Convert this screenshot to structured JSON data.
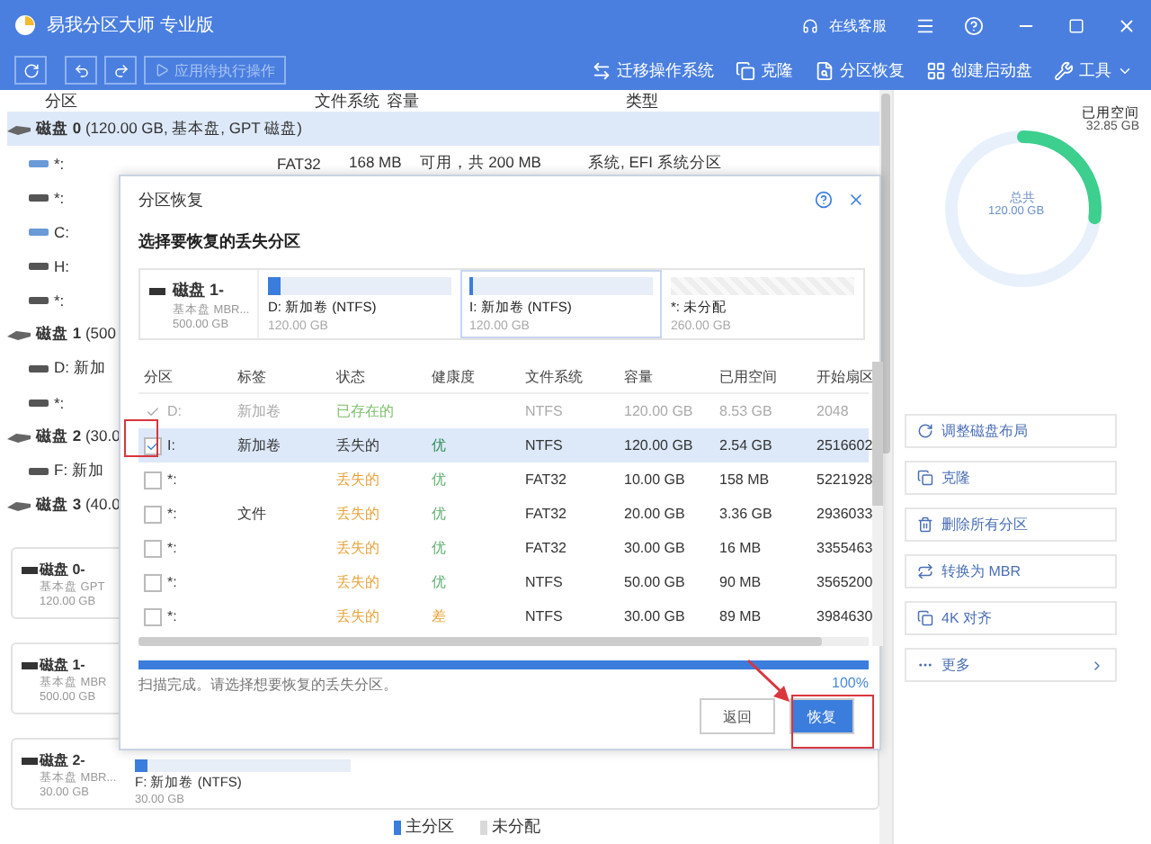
{
  "window": {
    "title": "易我分区大师 专业版",
    "support": "在线客服"
  },
  "toolbar": {
    "apply": {
      "label": "应用待执行操作",
      "disabled": true
    },
    "tools": [
      {
        "kind": "migrate",
        "label": "迁移操作系统"
      },
      {
        "kind": "clone",
        "label": "克隆"
      },
      {
        "kind": "recover",
        "label": "分区恢复"
      },
      {
        "kind": "bootdisk",
        "label": "创建启动盘"
      },
      {
        "kind": "tools",
        "label": "工具"
      }
    ]
  },
  "partition_table": {
    "columns": [
      "分区",
      "文件系统",
      "容量",
      "类型"
    ],
    "rows": [
      {
        "kind": "disk",
        "name": "磁盘 0",
        "detail": "(120.00 GB, 基本盘, GPT 磁盘)",
        "selected": true
      },
      {
        "kind": "partition",
        "name": "*:",
        "system": true,
        "filesystem": "FAT32",
        "capacity": "168 MB",
        "capacity_note": "可用，共 200 MB",
        "type": "系统, EFI 系统分区"
      },
      {
        "kind": "partition",
        "name": "*:",
        "system": false
      },
      {
        "kind": "partition",
        "name": "C:",
        "system": true
      },
      {
        "kind": "partition",
        "name": "H:",
        "system": false
      },
      {
        "kind": "partition",
        "name": "*:",
        "system": false
      },
      {
        "kind": "disk",
        "name": "磁盘 1",
        "detail": "(500",
        "selected": false
      },
      {
        "kind": "partition",
        "name": "D: 新加",
        "system": false
      },
      {
        "kind": "partition",
        "name": "*:",
        "system": false
      },
      {
        "kind": "disk",
        "name": "磁盘 2",
        "detail": "(30.0",
        "selected": false
      },
      {
        "kind": "partition",
        "name": "F: 新加",
        "system": false
      },
      {
        "kind": "disk",
        "name": "磁盘 3",
        "detail": "(40.0",
        "selected": false
      }
    ]
  },
  "disk_cards": [
    {
      "name": "磁盘 0-",
      "type": "基本盘 GPT",
      "size": "120.00 GB"
    },
    {
      "name": "磁盘 1-",
      "type": "基本盘 MBR",
      "size": "500.00 GB"
    },
    {
      "name": "磁盘 2-",
      "type": "基本盘 MBR...",
      "size": "30.00 GB",
      "partition": {
        "label": "F: 新加卷 (NTFS)",
        "size": "30.00 GB",
        "level": 0.06
      }
    }
  ],
  "legend": [
    {
      "label": "主分区",
      "color": "#3b7ddd"
    },
    {
      "label": "未分配",
      "color": "#d9d9d9"
    }
  ],
  "usage": {
    "used_label": "已用空间",
    "used": "32.85 GB",
    "total_label": "总共",
    "total": "120.00 GB",
    "level": 0.27
  },
  "actions": [
    {
      "kind": "layout",
      "label": "调整磁盘布局"
    },
    {
      "kind": "clone",
      "label": "克隆"
    },
    {
      "kind": "delete",
      "label": "删除所有分区"
    },
    {
      "kind": "convert",
      "label": "转换为 MBR"
    },
    {
      "kind": "align",
      "label": "4K 对齐"
    },
    {
      "kind": "more",
      "label": "更多"
    }
  ],
  "dialog": {
    "title": "分区恢复",
    "subtitle": "选择要恢复的丢失分区",
    "disk": {
      "name": "磁盘 1-",
      "type": "基本盘 MBR...",
      "size": "500.00 GB"
    },
    "segments": [
      {
        "kind": "partition",
        "label": "D: 新加卷 (NTFS)",
        "size": "120.00 GB",
        "level": 0.07,
        "selected": false
      },
      {
        "kind": "partition",
        "label": "I: 新加卷 (NTFS)",
        "size": "120.00 GB",
        "level": 0.02,
        "selected": true
      },
      {
        "kind": "unallocated",
        "label": "*: 未分配",
        "size": "260.00 GB",
        "selected": false
      }
    ],
    "columns": [
      "分区",
      "标签",
      "状态",
      "健康度",
      "文件系统",
      "容量",
      "已用空间",
      "开始扇区"
    ],
    "rows": [
      {
        "partition": "D:",
        "label": "新加卷",
        "status": {
          "text": "已存在的",
          "color": "#7cbf6a"
        },
        "filesystem": "NTFS",
        "capacity": "120.00 GB",
        "used": "8.53 GB",
        "start": "2048",
        "checked": true,
        "disabled": true,
        "selected": false
      },
      {
        "partition": "I:",
        "label": "新加卷",
        "status": {
          "text": "丢失的",
          "color": "#333333"
        },
        "health": {
          "text": "优",
          "color": "#2e8b57"
        },
        "filesystem": "NTFS",
        "capacity": "120.00 GB",
        "used": "2.54 GB",
        "start": "2516602",
        "checked": true,
        "disabled": false,
        "selected": true
      },
      {
        "partition": "*:",
        "status": {
          "text": "丢失的",
          "color": "#e8a33a"
        },
        "health": {
          "text": "优",
          "color": "#5fae6f"
        },
        "filesystem": "FAT32",
        "capacity": "10.00 GB",
        "used": "158 MB",
        "start": "5221928",
        "checked": false,
        "disabled": false,
        "selected": false
      },
      {
        "partition": "*:",
        "label": "文件",
        "status": {
          "text": "丢失的",
          "color": "#e8a33a"
        },
        "health": {
          "text": "优",
          "color": "#5fae6f"
        },
        "filesystem": "FAT32",
        "capacity": "20.00 GB",
        "used": "3.36 GB",
        "start": "2936033",
        "checked": false,
        "disabled": false,
        "selected": false
      },
      {
        "partition": "*:",
        "status": {
          "text": "丢失的",
          "color": "#e8a33a"
        },
        "health": {
          "text": "优",
          "color": "#5fae6f"
        },
        "filesystem": "FAT32",
        "capacity": "30.00 GB",
        "used": "16 MB",
        "start": "3355463",
        "checked": false,
        "disabled": false,
        "selected": false
      },
      {
        "partition": "*:",
        "status": {
          "text": "丢失的",
          "color": "#e8a33a"
        },
        "health": {
          "text": "优",
          "color": "#5fae6f"
        },
        "filesystem": "NTFS",
        "capacity": "50.00 GB",
        "used": "90 MB",
        "start": "3565200",
        "checked": false,
        "disabled": false,
        "selected": false
      },
      {
        "partition": "*:",
        "status": {
          "text": "丢失的",
          "color": "#e8a33a"
        },
        "health": {
          "text": "差",
          "color": "#e8a33a"
        },
        "filesystem": "NTFS",
        "capacity": "30.00 GB",
        "used": "89 MB",
        "start": "3984630",
        "checked": false,
        "disabled": false,
        "selected": false
      }
    ],
    "progress": {
      "level": 1,
      "message": "扫描完成。请选择想要恢复的丢失分区。",
      "percent": "100%"
    },
    "buttons": [
      {
        "kind": "secondary",
        "label": "返回"
      },
      {
        "kind": "primary",
        "label": "恢复"
      }
    ]
  }
}
